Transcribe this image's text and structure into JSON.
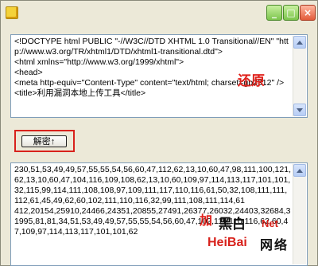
{
  "window": {
    "controls": {
      "minimize": "_",
      "maximize": "□",
      "close": "×"
    }
  },
  "source_box": {
    "text": "<!DOCTYPE html PUBLIC \"-//W3C//DTD XHTML 1.0 Transitional//EN\" \"http://www.w3.org/TR/xhtml1/DTD/xhtml1-transitional.dtd\">\n<html xmlns=\"http://www.w3.org/1999/xhtml\">\n<head>\n<meta http-equiv=\"Content-Type\" content=\"text/html; charset=gb2312\" />\n<title>利用漏洞本地上传工具</title>"
  },
  "restore_label": "还原",
  "decode_button": {
    "label": "解密↑"
  },
  "encoded_box": {
    "text": "230,51,53,49,49,57,55,55,54,56,60,47,112,62,13,10,60,47,98,111,100,121,62,13,10,60,47,104,116,109,108,62,13,10,60,109,97,114,113,117,101,101,32,115,99,114,111,108,108,97,109,111,117,110,116,61,50,32,108,111,111,112,61,45,49,62,60,102,111,110,116,32,99,111,108,111,114,61\n412,20154,25910,24466,24351,20855,27491,26377,26032,24403,32684,31995,81,81,34,51,53,49,49,57,55,55,54,56,60,47,102,111,110,116,62,60,47,109,97,114,113,117,101,101,62"
  },
  "overlay_label": "加",
  "watermark": {
    "cn": "黑白",
    "net": "Net",
    "en": "HeiBai",
    "net_cn": "网络"
  },
  "colors": {
    "accent_red": "#d8221c",
    "window_bg": "#ece9d8",
    "textbox_border": "#7f9db9"
  }
}
